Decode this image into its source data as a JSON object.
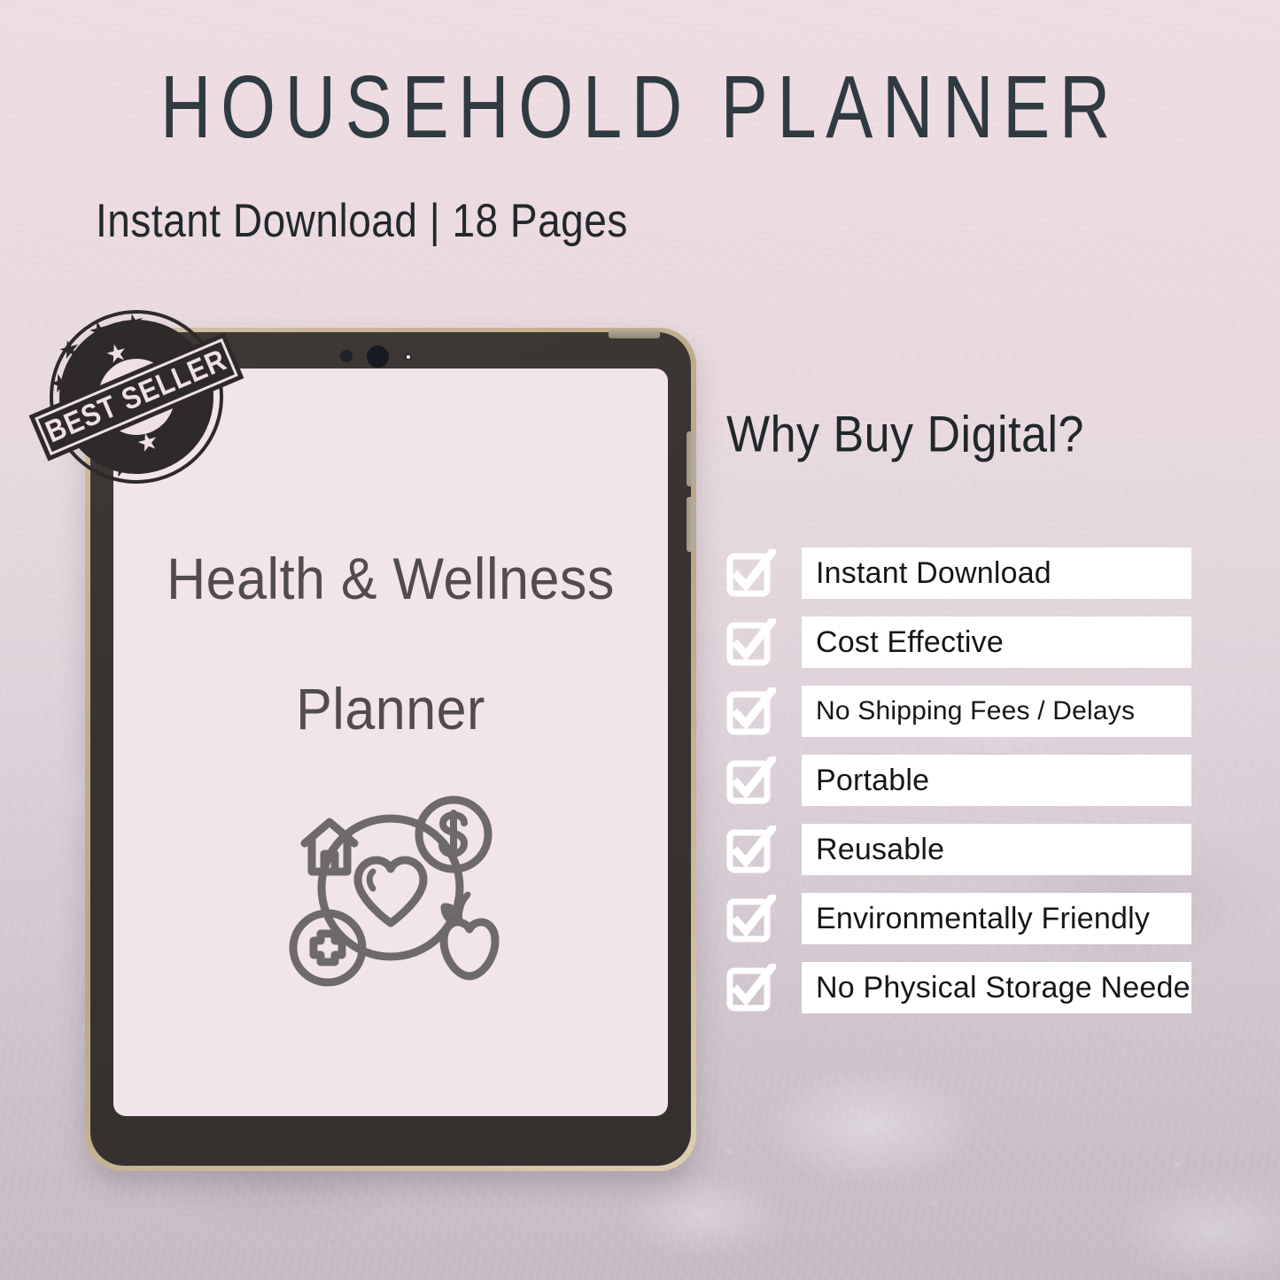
{
  "header": {
    "title": "HOUSEHOLD PLANNER",
    "subtitle": "Instant Download | 18 Pages"
  },
  "badge": {
    "label": "BEST SELLER",
    "icon": "best-seller-stamp-icon"
  },
  "tablet": {
    "screen": {
      "title_line1": "Health & Wellness",
      "title_line2": "Planner",
      "icon": "health-wellness-circle-icon"
    },
    "hardware": {
      "camera_icons": [
        "sensor-dot-icon",
        "camera-lens-icon",
        "flash-dot-icon"
      ],
      "buttons": [
        "power-button",
        "volume-up-button",
        "volume-down-button"
      ]
    }
  },
  "benefits": {
    "heading": "Why Buy Digital?",
    "items": [
      {
        "label": "Instant Download",
        "checked": true,
        "small": false
      },
      {
        "label": "Cost Effective",
        "checked": true,
        "small": false
      },
      {
        "label": "No Shipping Fees / Delays",
        "checked": true,
        "small": true
      },
      {
        "label": "Portable",
        "checked": true,
        "small": false
      },
      {
        "label": "Reusable",
        "checked": true,
        "small": false
      },
      {
        "label": "Environmentally Friendly",
        "checked": true,
        "small": false
      },
      {
        "label": "No Physical Storage Needed",
        "checked": true,
        "small": false
      }
    ]
  },
  "colors": {
    "background_top": "#eeddE3",
    "background_bottom": "#c9bec6",
    "title_text": "#2f3a41",
    "screen_background": "#f1e4ea",
    "screen_text": "#514c50",
    "tablet_body": "#383331",
    "tablet_edge": "#c6b494",
    "stamp_dark": "#2f2a2a",
    "row_background": "#ffffff",
    "row_text": "#141719"
  }
}
